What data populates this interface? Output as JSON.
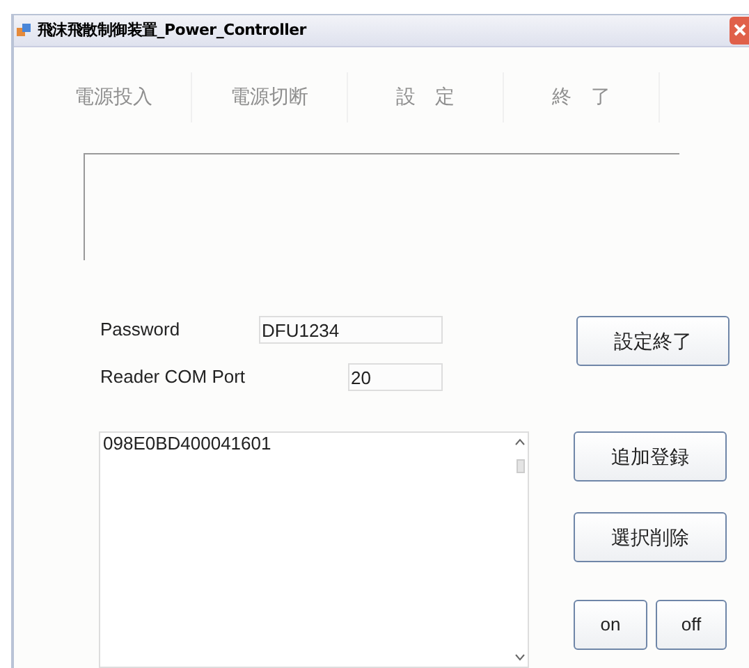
{
  "window": {
    "title": "飛沫飛散制御装置_Power_Controller"
  },
  "toolbar": [
    {
      "label": "電源投入",
      "disabled": true
    },
    {
      "label": "電源切断",
      "disabled": true
    },
    {
      "label": "設　定",
      "disabled": true
    },
    {
      "label": "終　了",
      "disabled": true
    }
  ],
  "password": {
    "label": "Password",
    "value": "DFU1234"
  },
  "com_port": {
    "label": "Reader COM Port",
    "value": "20"
  },
  "list": {
    "items": [
      "098E0BD400041601"
    ]
  },
  "buttons": [
    {
      "kind": "setting_done",
      "label": "設定終了"
    },
    {
      "kind": "add",
      "label": "追加登録"
    },
    {
      "kind": "delete",
      "label": "選択削除"
    },
    {
      "kind": "on",
      "label": "on"
    },
    {
      "kind": "off",
      "label": "off"
    }
  ]
}
